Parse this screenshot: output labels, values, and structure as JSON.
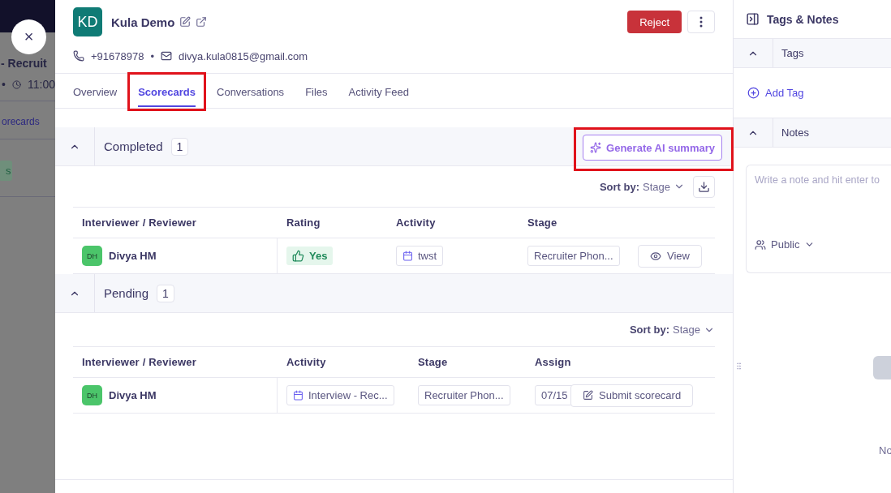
{
  "backdrop": {
    "title": "- Recruit",
    "separator": "•",
    "time": "11:00",
    "tab": "orecards",
    "badge": "s"
  },
  "close_button": {
    "label": "×"
  },
  "candidate": {
    "initials": "KD",
    "name": "Kula Demo",
    "phone": "+91678978",
    "separator": "•",
    "email": "divya.kula0815@gmail.com"
  },
  "actions": {
    "reject": "Reject"
  },
  "tabs": [
    {
      "label": "Overview",
      "selected": false,
      "highlighted": false
    },
    {
      "label": "Scorecards",
      "selected": true,
      "highlighted": true
    },
    {
      "label": "Conversations",
      "selected": false,
      "highlighted": false
    },
    {
      "label": "Files",
      "selected": false,
      "highlighted": false
    },
    {
      "label": "Activity Feed",
      "selected": false,
      "highlighted": false
    }
  ],
  "sections": [
    {
      "title": "Completed",
      "count": "1",
      "expanded": true,
      "ai_button": {
        "label": "Generate AI summary",
        "highlighted": true
      },
      "sort": {
        "label": "Sort by:",
        "value": "Stage"
      },
      "download": true,
      "columns": [
        "Interviewer / Reviewer",
        "Rating",
        "Activity",
        "Stage"
      ],
      "rows": [
        {
          "cells": [
            {
              "kind": "reviewer",
              "initials": "DH",
              "text": "Divya HM"
            },
            {
              "kind": "rating",
              "text": "Yes"
            },
            {
              "kind": "activity",
              "text": "twst"
            },
            {
              "kind": "stage",
              "text": "Recruiter Phon..."
            },
            {
              "kind": "view",
              "text": "View"
            }
          ]
        }
      ]
    },
    {
      "title": "Pending",
      "count": "1",
      "expanded": true,
      "sort": {
        "label": "Sort by:",
        "value": "Stage"
      },
      "download": false,
      "columns": [
        "Interviewer / Reviewer",
        "Activity",
        "Stage",
        "Assign"
      ],
      "rows": [
        {
          "cells": [
            {
              "kind": "reviewer",
              "initials": "DH",
              "text": "Divya HM"
            },
            {
              "kind": "activity",
              "text": "Interview - Rec..."
            },
            {
              "kind": "stage",
              "text": "Recruiter Phon..."
            },
            {
              "kind": "date",
              "text": "07/15"
            },
            {
              "kind": "submit",
              "text": "Submit scorecard"
            }
          ]
        }
      ]
    }
  ],
  "side_panel": {
    "title": "Tags & Notes",
    "tags": {
      "title": "Tags",
      "expanded": true,
      "add_label": "Add Tag"
    },
    "notes": {
      "title": "Notes",
      "expanded": true,
      "placeholder": "Write a note and hit enter to",
      "visibility": "Public",
      "empty_text": "No"
    }
  }
}
